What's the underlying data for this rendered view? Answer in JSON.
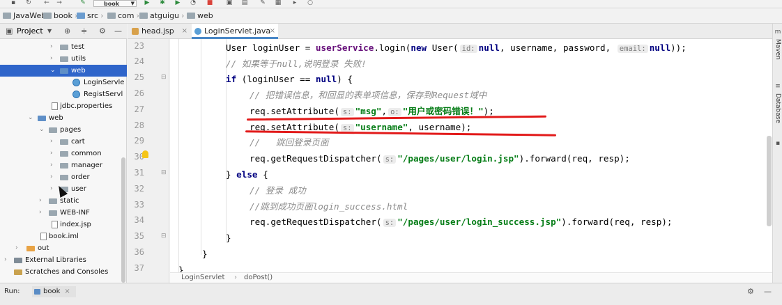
{
  "toolbar": {
    "run_config": "book",
    "colors": {
      "run_green": "#2e8b3d",
      "stop_red": "#d9433b"
    }
  },
  "breadcrumb": [
    "JavaWeb",
    "book",
    "src",
    "com",
    "atguigu",
    "web"
  ],
  "project_panel": {
    "title": "Project",
    "tree": [
      {
        "label": "test",
        "type": "folder"
      },
      {
        "label": "utils",
        "type": "folder"
      },
      {
        "label": "web",
        "type": "folder",
        "selected": true
      },
      {
        "label": "LoginServle",
        "type": "class"
      },
      {
        "label": "RegistServl",
        "type": "class"
      },
      {
        "label": "jdbc.properties",
        "type": "file"
      },
      {
        "label": "web",
        "type": "folder"
      },
      {
        "label": "pages",
        "type": "folder"
      },
      {
        "label": "cart",
        "type": "folder"
      },
      {
        "label": "common",
        "type": "folder"
      },
      {
        "label": "manager",
        "type": "folder"
      },
      {
        "label": "order",
        "type": "folder"
      },
      {
        "label": "user",
        "type": "folder"
      },
      {
        "label": "static",
        "type": "folder"
      },
      {
        "label": "WEB-INF",
        "type": "folder"
      },
      {
        "label": "index.jsp",
        "type": "file"
      },
      {
        "label": "book.iml",
        "type": "file"
      },
      {
        "label": "out",
        "type": "folder"
      },
      {
        "label": "External Libraries",
        "type": "lib"
      },
      {
        "label": "Scratches and Consoles",
        "type": "lib"
      }
    ]
  },
  "editor": {
    "tabs": [
      {
        "label": "head.jsp",
        "active": false
      },
      {
        "label": "LoginServlet.java",
        "active": true
      }
    ],
    "line_numbers": [
      "23",
      "24",
      "25",
      "26",
      "27",
      "28",
      "29",
      "30",
      "31",
      "32",
      "33",
      "34",
      "35",
      "36",
      "37"
    ],
    "code": {
      "l23_a": "User loginUser = ",
      "l23_b": "userService",
      "l23_c": ".login(",
      "l23_d": "new",
      "l23_e": " User(",
      "l23_h1": "id:",
      "l23_f": "null",
      "l23_g": ", username, password, ",
      "l23_h2": "email:",
      "l23_i": "null",
      "l23_j": "));",
      "l24": "// 如果等于null,说明登录 失败!",
      "l25_a": "if",
      "l25_b": " (loginUser == ",
      "l25_c": "null",
      "l25_d": ") {",
      "l26": "// 把错误信息，和回显的表单项信息，保存到Request域中",
      "l27_a": "req.setAttribute(",
      "l27_h1": "s:",
      "l27_b": "\"msg\"",
      "l27_c": ",",
      "l27_h2": "o:",
      "l27_d": "\"用户或密码错误！\"",
      "l27_e": ");",
      "l28_a": "req.setAttribute(",
      "l28_h1": "s:",
      "l28_b": "\"username\"",
      "l28_c": ", username);",
      "l29": "//   跳回登录页面",
      "l30_a": "req.getRequestDispatcher(",
      "l30_h1": "s:",
      "l30_b": "\"/pages/user/login.jsp\"",
      "l30_c": ").forward(req, resp);",
      "l31_a": "} ",
      "l31_b": "else",
      "l31_c": " {",
      "l32": "// 登录 成功",
      "l33": "//跳到成功页面login_success.html",
      "l34_a": "req.getRequestDispatcher(",
      "l34_h1": "s:",
      "l34_b": "\"/pages/user/login_success.jsp\"",
      "l34_c": ").forward(req, resp);",
      "l35": "}",
      "l36": "}",
      "l37": "}"
    },
    "bottom_breadcrumb": [
      "LoginServlet",
      "doPost()"
    ]
  },
  "right_strip": {
    "items": [
      "Maven",
      "Database"
    ]
  },
  "run_bar": {
    "label": "Run:",
    "config": "book"
  }
}
